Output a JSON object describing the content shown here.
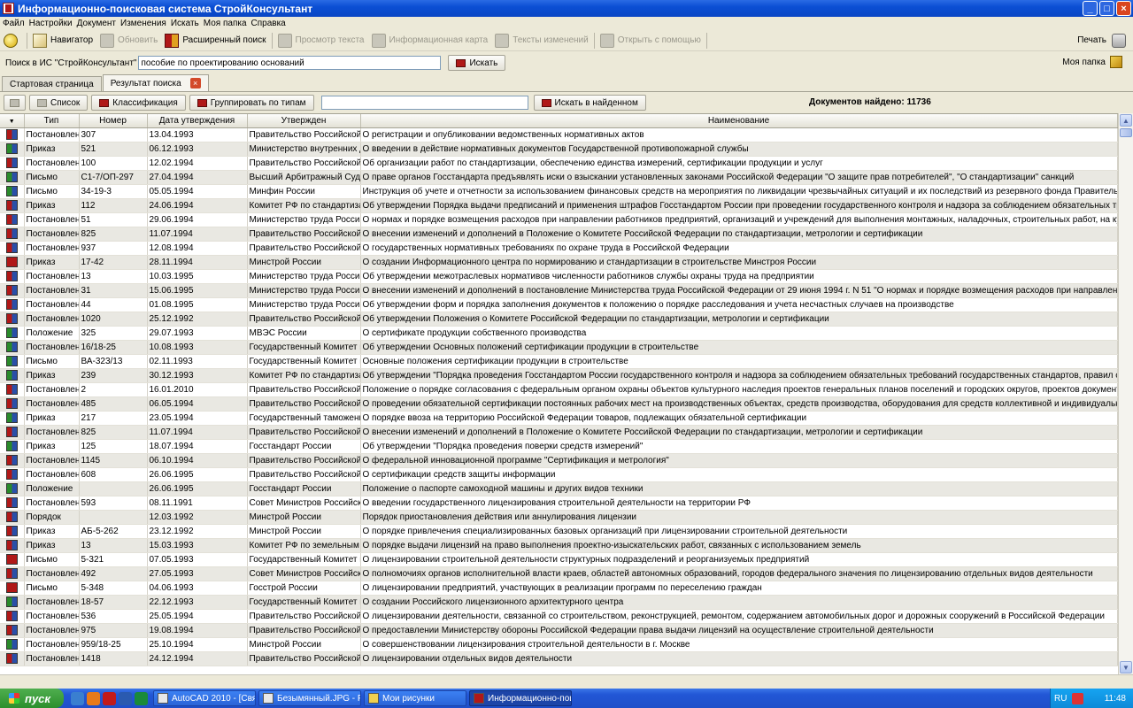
{
  "window": {
    "title": "Информационно-поисковая система СтройКонсультант"
  },
  "menu": [
    "Файл",
    "Настройки",
    "Документ",
    "Изменения",
    "Искать",
    "Моя папка",
    "Справка"
  ],
  "toolbar": {
    "navigator": "Навигатор",
    "refresh": "Обновить",
    "advanced_search": "Расширенный поиск",
    "view_text": "Просмотр текста",
    "info_card": "Информационная карта",
    "change_texts": "Тексты изменений",
    "open_with": "Открыть с помощью",
    "print": "Печать"
  },
  "search": {
    "label": "Поиск в ИС \"СтройКонсультант\"",
    "query": "пособие по проектированию оснований",
    "button": "Искать",
    "my_folder": "Моя папка"
  },
  "tabs": [
    {
      "label": "Стартовая страница"
    },
    {
      "label": "Результат поиска"
    }
  ],
  "results_toolbar": {
    "list": "Список",
    "classification": "Классификация",
    "group_by_type": "Группировать по типам",
    "search_in_found": "Искать в найденном",
    "found_label": "Документов найдено: 11736"
  },
  "columns": [
    "Тип",
    "Номер",
    "Дата утверждения",
    "Утвержден",
    "Наименование"
  ],
  "rows": [
    {
      "icon": "rb",
      "type": "Постановление",
      "num": "307",
      "date": "13.04.1993",
      "org": "Правительство Российской Феде",
      "name": "О регистрации и опубликовании ведомственных нормативных актов"
    },
    {
      "icon": "gr",
      "type": "Приказ",
      "num": "521",
      "date": "06.12.1993",
      "org": "Министерство внутренних дел Р",
      "name": "О введении в действие нормативных документов Государственной противопожарной службы"
    },
    {
      "icon": "rb",
      "type": "Постановление",
      "num": "100",
      "date": "12.02.1994",
      "org": "Правительство Российской Феде",
      "name": "Об организации работ по стандартизации, обеспечению единства измерений, сертификации продукции и услуг"
    },
    {
      "icon": "gr",
      "type": "Письмо",
      "num": "С1-7/ОП-297",
      "date": "27.04.1994",
      "org": "Высший Арбитражный Суд РФ",
      "name": "О праве органов Госстандарта предъявлять иски о взыскании установленных законами Российской Федерации \"О защите прав потребителей\", \"О стандартизации\" санкций"
    },
    {
      "icon": "gr",
      "type": "Письмо",
      "num": "34-19-3",
      "date": "05.05.1994",
      "org": "Минфин России",
      "name": "Инструкция об учете и отчетности за использованием финансовых средств на мероприятия по ликвидации чрезвычайных ситуаций и их последствий из резервного фонда Правительства Российской Федерации на"
    },
    {
      "icon": "rb",
      "type": "Приказ",
      "num": "112",
      "date": "24.06.1994",
      "org": "Комитет РФ по стандартизации,",
      "name": "Об утверждении Порядка выдачи предписаний и применения штрафов Госстандартом России при проведении государственного контроля и надзора за соблюдением обязательных требований государственных станд"
    },
    {
      "icon": "rb",
      "type": "Постановление",
      "num": "51",
      "date": "29.06.1994",
      "org": "Министерство труда Российской",
      "name": "О нормах и порядке возмещения расходов при направлении работников предприятий, организаций и учреждений для выполнения монтажных, наладочных, строительных работ, на курсы повышения квалификации,"
    },
    {
      "icon": "rb",
      "type": "Постановление",
      "num": "825",
      "date": "11.07.1994",
      "org": "Правительство Российской Феде",
      "name": "О внесении изменений и дополнений в Положение о Комитете Российской Федерации по стандартизации, метрологии и сертификации"
    },
    {
      "icon": "rb",
      "type": "Постановление",
      "num": "937",
      "date": "12.08.1994",
      "org": "Правительство Российской Феде",
      "name": "О государственных нормативных требованиях по охране труда в Российской Федерации"
    },
    {
      "icon": "r",
      "type": "Приказ",
      "num": "17-42",
      "date": "28.11.1994",
      "org": "Минстрой России",
      "name": "О создании Информационного центра по нормированию и стандартизации в строительстве Минстроя России"
    },
    {
      "icon": "rb",
      "type": "Постановление",
      "num": "13",
      "date": "10.03.1995",
      "org": "Министерство труда Российской",
      "name": "Об утверждении межотраслевых нормативов численности работников службы охраны труда на предприятии"
    },
    {
      "icon": "rb",
      "type": "Постановление",
      "num": "31",
      "date": "15.06.1995",
      "org": "Министерство труда Российской",
      "name": "О внесении изменений и дополнений в постановление Министерства труда Российской Федерации от 29 июня 1994 г. N 51 \"О нормах и порядке возмещения расходов при направлении работников предприятий, органи"
    },
    {
      "icon": "rb",
      "type": "Постановление",
      "num": "44",
      "date": "01.08.1995",
      "org": "Министерство труда Российской",
      "name": "Об утверждении форм и порядка заполнения документов к положению о порядке расследования и учета несчастных случаев на производстве"
    },
    {
      "icon": "rb",
      "type": "Постановление",
      "num": "1020",
      "date": "25.12.1992",
      "org": "Правительство Российской Феде",
      "name": "Об утверждении Положения о Комитете Российской Федерации по стандартизации, метрологии и сертификации"
    },
    {
      "icon": "gr",
      "type": "Положение",
      "num": "325",
      "date": "29.07.1993",
      "org": "МВЭС России",
      "name": "О сертификате продукции собственного производства"
    },
    {
      "icon": "gr",
      "type": "Постановление",
      "num": "16/18-25",
      "date": "10.08.1993",
      "org": "Государственный Комитет по во",
      "name": "Об утверждении Основных положений сертификации продукции в строительстве"
    },
    {
      "icon": "gr",
      "type": "Письмо",
      "num": "ВА-323/13",
      "date": "02.11.1993",
      "org": "Государственный Комитет по во",
      "name": "Основные положения сертификации продукции в строительстве"
    },
    {
      "icon": "gr",
      "type": "Приказ",
      "num": "239",
      "date": "30.12.1993",
      "org": "Комитет РФ по стандартизации,",
      "name": "Об утверждении \"Порядка проведения Госстандартом России государственного контроля и надзора за соблюдением обязательных требований государственных стандартов, правил обязательной сертификации и за"
    },
    {
      "icon": "rb",
      "type": "Постановление",
      "num": "2",
      "date": "16.01.2010",
      "org": "Правительство Российской Феде",
      "name": "Положение о порядке согласования с федеральным органом охраны объектов культурного наследия проектов генеральных планов поселений и городских округов, проектов документации по планировке территори"
    },
    {
      "icon": "rb",
      "type": "Постановление",
      "num": "485",
      "date": "06.05.1994",
      "org": "Правительство Российской Феде",
      "name": "О проведении обязательной сертификации постоянных рабочих мест на производственных объектах, средств производства, оборудования для средств коллективной и индивидуальной защиты"
    },
    {
      "icon": "gr",
      "type": "Приказ",
      "num": "217",
      "date": "23.05.1994",
      "org": "Государственный таможенный к",
      "name": "О порядке ввоза на территорию Российской Федерации товаров, подлежащих обязательной сертификации"
    },
    {
      "icon": "rb",
      "type": "Постановление",
      "num": "825",
      "date": "11.07.1994",
      "org": "Правительство Российской Феде",
      "name": "О внесении изменений и дополнений в Положение о Комитете Российской Федерации по стандартизации, метрологии и сертификации"
    },
    {
      "icon": "gr",
      "type": "Приказ",
      "num": "125",
      "date": "18.07.1994",
      "org": "Госстандарт России",
      "name": "Об утверждении \"Порядка проведения поверки средств измерений\""
    },
    {
      "icon": "rb",
      "type": "Постановление",
      "num": "1145",
      "date": "06.10.1994",
      "org": "Правительство Российской Феде",
      "name": "О федеральной инновационной программе \"Сертификация и метрология\""
    },
    {
      "icon": "rb",
      "type": "Постановление",
      "num": "608",
      "date": "26.06.1995",
      "org": "Правительство Российской Феде",
      "name": "О сертификации средств защиты информации"
    },
    {
      "icon": "gr",
      "type": "Положение",
      "num": "",
      "date": "26.06.1995",
      "org": "Госстандарт России",
      "name": "Положение о паспорте самоходной машины и других видов техники"
    },
    {
      "icon": "rb",
      "type": "Постановление",
      "num": "593",
      "date": "08.11.1991",
      "org": "Совет Министров Российской Фе",
      "name": "О введении государственного лицензирования строительной деятельности на территории РФ"
    },
    {
      "icon": "rb",
      "type": "Порядок",
      "num": "",
      "date": "12.03.1992",
      "org": "Минстрой России",
      "name": "Порядок приостановления действия или аннулирования лицензии"
    },
    {
      "icon": "rb",
      "type": "Приказ",
      "num": "АБ-5-262",
      "date": "23.12.1992",
      "org": "Минстрой России",
      "name": "О порядке привлечения специализированных базовых организаций при лицензировании строительной деятельности"
    },
    {
      "icon": "rb",
      "type": "Приказ",
      "num": "13",
      "date": "15.03.1993",
      "org": "Комитет РФ по земельным ресур",
      "name": "О порядке выдачи лицензий на право выполнения проектно-изыскательских работ, связанных с использованием земель"
    },
    {
      "icon": "r",
      "type": "Письмо",
      "num": "5-321",
      "date": "07.05.1993",
      "org": "Государственный Комитет по во",
      "name": "О лицензировании строительной деятельности структурных подразделений и реорганизуемых предприятий"
    },
    {
      "icon": "rb",
      "type": "Постановление",
      "num": "492",
      "date": "27.05.1993",
      "org": "Совет Министров Российской Фе",
      "name": "О полномочиях органов исполнительной власти краев, областей автономных образований, городов федерального значения по лицензированию отдельных видов деятельности"
    },
    {
      "icon": "r",
      "type": "Письмо",
      "num": "5-348",
      "date": "04.06.1993",
      "org": "Госстрой России",
      "name": "О лицензировании предприятий, участвующих в реализации программ по переселению граждан"
    },
    {
      "icon": "gr",
      "type": "Постановление",
      "num": "18-57",
      "date": "22.12.1993",
      "org": "Государственный Комитет по во",
      "name": "О создании Российского лицензионного архитектурного центра"
    },
    {
      "icon": "rb",
      "type": "Постановление",
      "num": "536",
      "date": "25.05.1994",
      "org": "Правительство Российской Феде",
      "name": "О лицензировании деятельности, связанной со строительством, реконструкцией, ремонтом, содержанием автомобильных дорог и дорожных сооружений в Российской Федерации"
    },
    {
      "icon": "rb",
      "type": "Постановление",
      "num": "975",
      "date": "19.08.1994",
      "org": "Правительство Российской Феде",
      "name": "О предоставлении Министерству обороны Российской Федерации права выдачи лицензий на осуществление строительной деятельности"
    },
    {
      "icon": "gr",
      "type": "Постановление",
      "num": "959/18-25",
      "date": "25.10.1994",
      "org": "Минстрой России",
      "name": "О совершенствовании лицензирования строительной деятельности в г. Москве"
    },
    {
      "icon": "rb",
      "type": "Постановление",
      "num": "1418",
      "date": "24.12.1994",
      "org": "Правительство Российской Феде",
      "name": "О лицензировании отдельных видов деятельности"
    }
  ],
  "taskbar": {
    "start": "пуск",
    "tasks": [
      "AutoCAD 2010 - [Свя...",
      "Безымянный.JPG - P...",
      "Мои рисунки",
      "Информационно-пои..."
    ],
    "lang": "RU",
    "clock": "11:48"
  }
}
